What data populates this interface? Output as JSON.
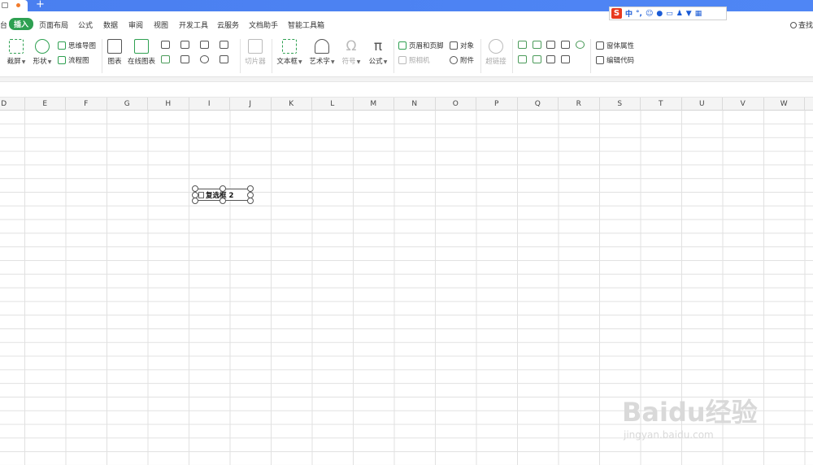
{
  "tabs": {
    "new_tab": "+"
  },
  "menu": {
    "items": [
      "页面布局",
      "公式",
      "数据",
      "审阅",
      "视图",
      "开发工具",
      "云服务",
      "文档助手",
      "智能工具箱"
    ],
    "active": "插入",
    "left_cut": "台",
    "search": "查找"
  },
  "ime": {
    "logo": "S",
    "mode": "中",
    "punct": "°,"
  },
  "ribbon": {
    "screenshot": "截屏",
    "shapes": "形状",
    "mindmap": "思维导图",
    "flowchart": "流程图",
    "chart": "图表",
    "online_chart": "在线图表",
    "slicer": "切片器",
    "textbox": "文本框",
    "wordart": "艺术字",
    "symbol": "符号",
    "formula": "公式",
    "header_footer": "页眉和页脚",
    "object": "对象",
    "camera": "照相机",
    "attachment": "附件",
    "hyperlink": "超链接",
    "window_props": "窗体属性",
    "edit_code": "编辑代码"
  },
  "columns": [
    "D",
    "E",
    "F",
    "G",
    "H",
    "I",
    "J",
    "K",
    "L",
    "M",
    "N",
    "O",
    "P",
    "Q",
    "R",
    "S",
    "T",
    "U",
    "V",
    "W"
  ],
  "checkbox": {
    "label": "复选框 2"
  },
  "watermark": {
    "main": "Baidu经验",
    "sub": "jingyan.baidu.com"
  }
}
